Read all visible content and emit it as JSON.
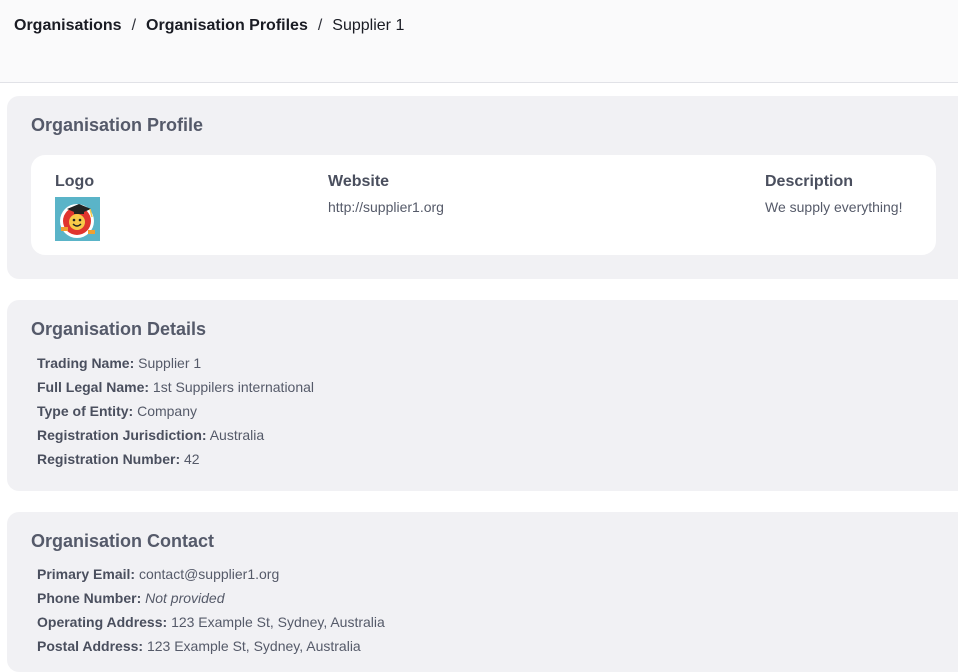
{
  "breadcrumb": {
    "items": [
      "Organisations",
      "Organisation Profiles"
    ],
    "separator": "/",
    "current": "Supplier 1"
  },
  "profile": {
    "title": "Organisation Profile",
    "logo_label": "Logo",
    "website_label": "Website",
    "website_value": "http://supplier1.org",
    "description_label": "Description",
    "description_value": "We supply everything!"
  },
  "details": {
    "title": "Organisation Details",
    "rows": [
      {
        "label": "Trading Name:",
        "value": "Supplier 1"
      },
      {
        "label": "Full Legal Name:",
        "value": "1st Suppilers international"
      },
      {
        "label": "Type of Entity:",
        "value": "Company"
      },
      {
        "label": "Registration Jurisdiction:",
        "value": "Australia"
      },
      {
        "label": "Registration Number:",
        "value": "42"
      }
    ]
  },
  "contact": {
    "title": "Organisation Contact",
    "rows": [
      {
        "label": "Primary Email:",
        "value": "contact@supplier1.org"
      },
      {
        "label": "Phone Number:",
        "value": "Not provided"
      },
      {
        "label": "Operating Address:",
        "value": "123 Example St, Sydney, Australia"
      },
      {
        "label": "Postal Address:",
        "value": "123 Example St, Sydney, Australia"
      }
    ]
  },
  "colors": {
    "card_bg": "#f1f1f4",
    "heading": "#555a6a",
    "logo_bg": "#5ab4c8",
    "logo_red": "#e0342e"
  },
  "icons": {
    "logo": "emoji-face-with-graduation-cap"
  }
}
